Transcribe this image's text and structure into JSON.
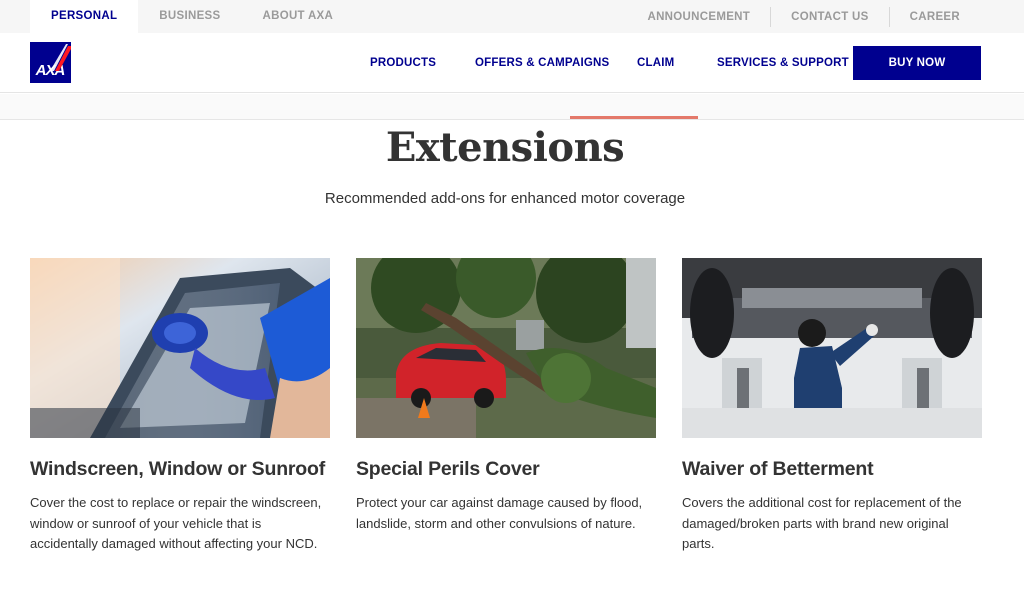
{
  "topbar": {
    "tabs": [
      {
        "label": "PERSONAL"
      },
      {
        "label": "BUSINESS"
      },
      {
        "label": "ABOUT AXA"
      }
    ],
    "links": [
      {
        "label": "ANNOUNCEMENT"
      },
      {
        "label": "CONTACT US"
      },
      {
        "label": "CAREER"
      }
    ]
  },
  "nav": {
    "logo_text": "AXA",
    "items": [
      {
        "label": "PRODUCTS"
      },
      {
        "label": "OFFERS & CAMPAIGNS"
      },
      {
        "label": "CLAIM"
      },
      {
        "label": "SERVICES & SUPPORT"
      }
    ],
    "cta_label": "BUY NOW"
  },
  "section": {
    "title": "Extensions",
    "subtitle": "Recommended add-ons for enhanced motor coverage"
  },
  "cards": [
    {
      "title": "Windscreen, Window or Sunroof",
      "description": "Cover the cost to replace or repair the windscreen, window or sunroof of your vehicle that is accidentally damaged without affecting your NCD."
    },
    {
      "title": "Special Perils Cover",
      "description": "Protect your car against damage caused by flood, landslide, storm and other convulsions of nature."
    },
    {
      "title": "Waiver of Betterment",
      "description": "Covers the additional cost for replacement of the damaged/broken parts with brand new original parts."
    }
  ],
  "colors": {
    "brand_blue": "#00008f",
    "accent_red": "#e4796a",
    "text": "#333333",
    "muted": "#9a9a9a"
  }
}
